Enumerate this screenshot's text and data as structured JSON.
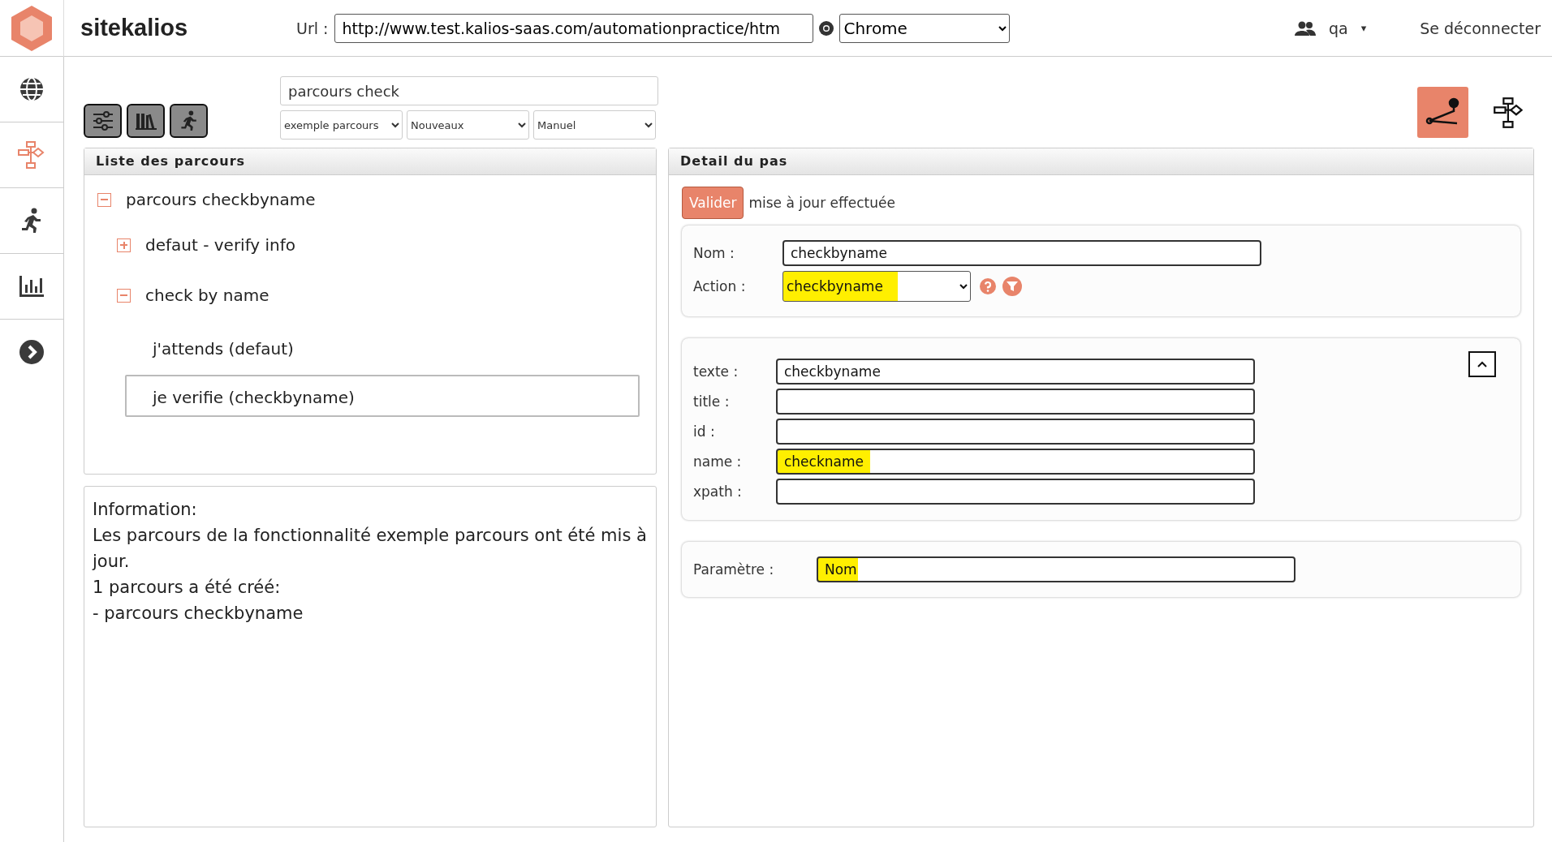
{
  "header": {
    "title": "sitekalios",
    "url_label": "Url :",
    "url": "http://www.test.kalios-saas.com/automationpractice/htm",
    "browser": "Chrome",
    "user": "qa",
    "user_caret": "▾",
    "logout": "Se déconnecter"
  },
  "sidebar": {
    "items": [
      {
        "kind": "globe",
        "selected": false
      },
      {
        "kind": "flowchart",
        "selected": true
      },
      {
        "kind": "runner",
        "selected": false
      },
      {
        "kind": "chart",
        "selected": false
      },
      {
        "kind": "next",
        "selected": false
      }
    ]
  },
  "toolbar": {
    "search": "parcours check",
    "filters": [
      "exemple parcours",
      "Nouveaux",
      "Manuel"
    ],
    "views": [
      {
        "kind": "route",
        "selected": true
      },
      {
        "kind": "flowchart",
        "selected": false
      }
    ]
  },
  "tree_panel": {
    "title": "Liste des parcours",
    "items": [
      {
        "label": "parcours checkbyname",
        "expanded": true,
        "selected": false,
        "children": [
          {
            "label": "defaut - verify info",
            "expanded": false,
            "selected": false
          },
          {
            "label": "check by name",
            "expanded": true,
            "selected": false,
            "children": [
              {
                "label": "j'attends (defaut)",
                "selected": false
              },
              {
                "label": "je verifie (checkbyname)",
                "selected": true
              }
            ]
          }
        ]
      }
    ]
  },
  "info_panel": {
    "title": "Information:",
    "lines": [
      "Les parcours de la fonctionnalité exemple parcours ont été mis à jour.",
      "1 parcours a été créé:",
      "- parcours checkbyname"
    ]
  },
  "detail_panel": {
    "title": "Detail du pas",
    "validate": "Valider",
    "status": "mise à jour effectuée",
    "name": {
      "label": "Nom :",
      "value": "checkbyname",
      "highlighted": false
    },
    "action": {
      "label": "Action :",
      "value": "checkbyname",
      "highlighted": true
    },
    "locators": [
      {
        "label": "texte :",
        "value": "checkbyname",
        "highlighted": false
      },
      {
        "label": "title :",
        "highlighted": false
      },
      {
        "label": "id :",
        "highlighted": false
      },
      {
        "label": "name :",
        "value": "checkname",
        "highlighted": true
      },
      {
        "label": "xpath :",
        "highlighted": false
      }
    ],
    "parameter": {
      "label": "Paramètre :",
      "value": "Nom",
      "highlighted": true
    }
  }
}
